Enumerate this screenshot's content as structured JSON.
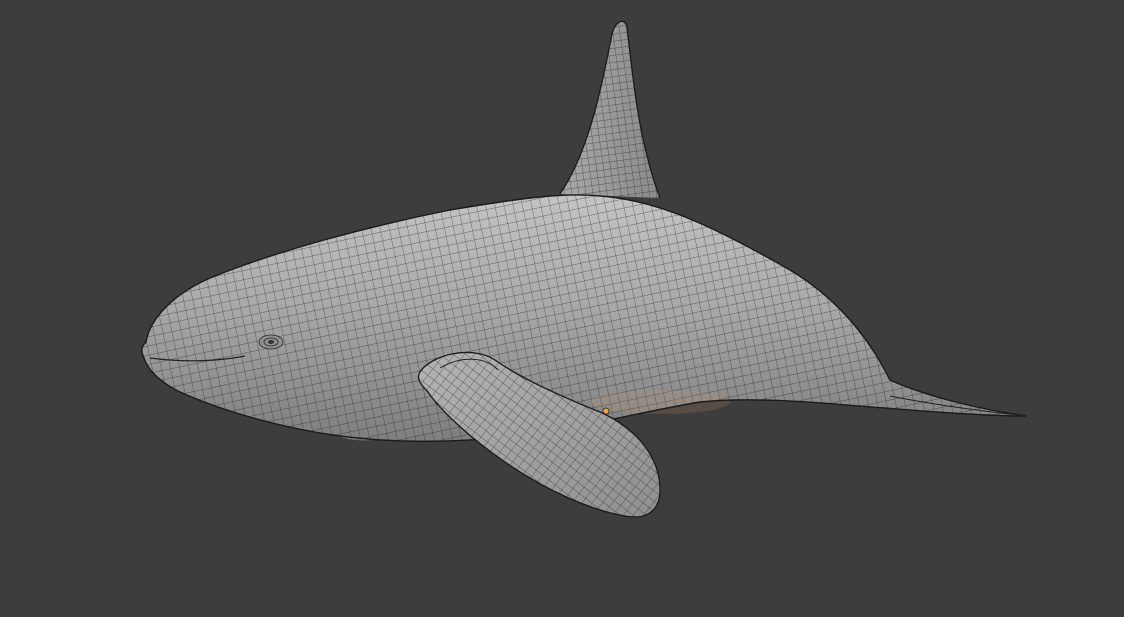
{
  "app": {
    "editor": "3D Viewport",
    "shading_mode": "solid",
    "overlay": "wireframe",
    "background_color": "#3d3d3d"
  },
  "scene": {
    "object_type": "mesh",
    "subject": "orca",
    "mesh_color": "#a6a6a6",
    "wire_color": "#1c1c1c",
    "origin_color": "#f3a443",
    "has_object_origin_marker": true
  }
}
